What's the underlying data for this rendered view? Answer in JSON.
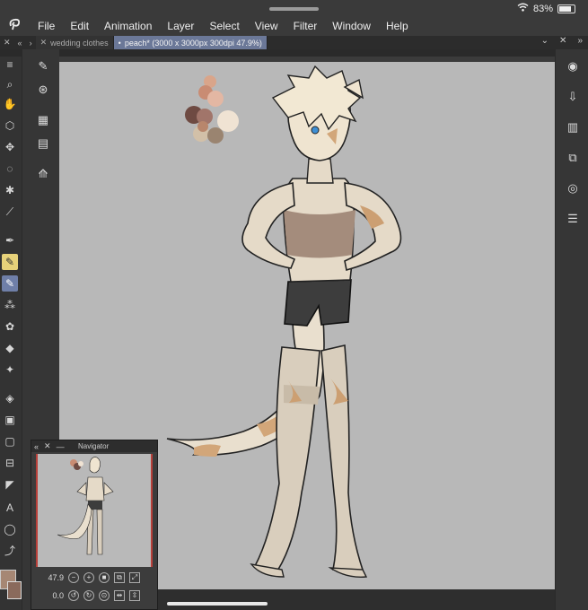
{
  "status": {
    "battery": "83%",
    "battery_level": 0.83
  },
  "menu": {
    "logo_icon": "clip-studio-logo-icon",
    "items": [
      "File",
      "Edit",
      "Animation",
      "Layer",
      "Select",
      "View",
      "Filter",
      "Window",
      "Help"
    ]
  },
  "tabs": [
    {
      "label": "wedding clothes",
      "active": false
    },
    {
      "label": "peach* (3000 x 3000px 300dpi 47.9%)",
      "active": true
    }
  ],
  "navigator": {
    "title": "Navigator",
    "zoom": "47.9",
    "rotation": "0.0"
  },
  "colors": {
    "main": "#a68774",
    "sub": "#8a6a5c",
    "canvas_bg": "#b8b8b8",
    "active_tab": "#6b7898",
    "palette": [
      "#d9a58a",
      "#c98c73",
      "#e3b7a3",
      "#6e4a42",
      "#a1756a",
      "#d2c0a8",
      "#f0e3d3",
      "#9a8470",
      "#b8866c"
    ]
  }
}
